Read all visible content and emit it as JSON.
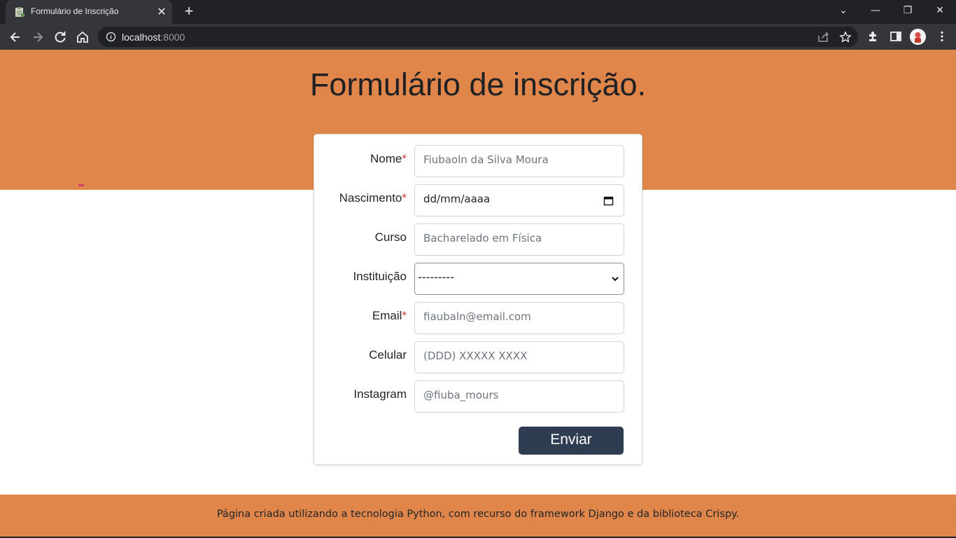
{
  "browser": {
    "tab_title": "Formulário de Inscrição",
    "tab_close": "✕",
    "new_tab": "+",
    "url_host": "localhost",
    "url_port": ":8000",
    "window_controls": {
      "tabsearch": "⌄",
      "minimize": "—",
      "restore": "❐",
      "close": "✕"
    }
  },
  "page": {
    "title": "Formulário de inscrição.",
    "form": {
      "fields": [
        {
          "label": "Nome",
          "required": "*",
          "placeholder": "Fiubaoln da Silva Moura"
        },
        {
          "label": "Nascimento",
          "required": "*",
          "value": "dd/mm/aaaa"
        },
        {
          "label": "Curso",
          "required": "",
          "placeholder": "Bacharelado em Física"
        },
        {
          "label": "Instituição",
          "required": "",
          "value": "---------"
        },
        {
          "label": "Email",
          "required": "*",
          "placeholder": "fiaubaln@email.com"
        },
        {
          "label": "Celular",
          "required": "",
          "placeholder": "(DDD) XXXXX XXXX"
        },
        {
          "label": "Instagram",
          "required": "",
          "placeholder": "@fiuba_mours"
        }
      ],
      "submit_label": "Enviar"
    },
    "footer": "Página criada utilizando a tecnologia Python, com recurso do framework Django e da biblioteca Crispy."
  },
  "colors": {
    "accent": "#e0864a",
    "button": "#2e3d52",
    "required": "#dc3545"
  }
}
